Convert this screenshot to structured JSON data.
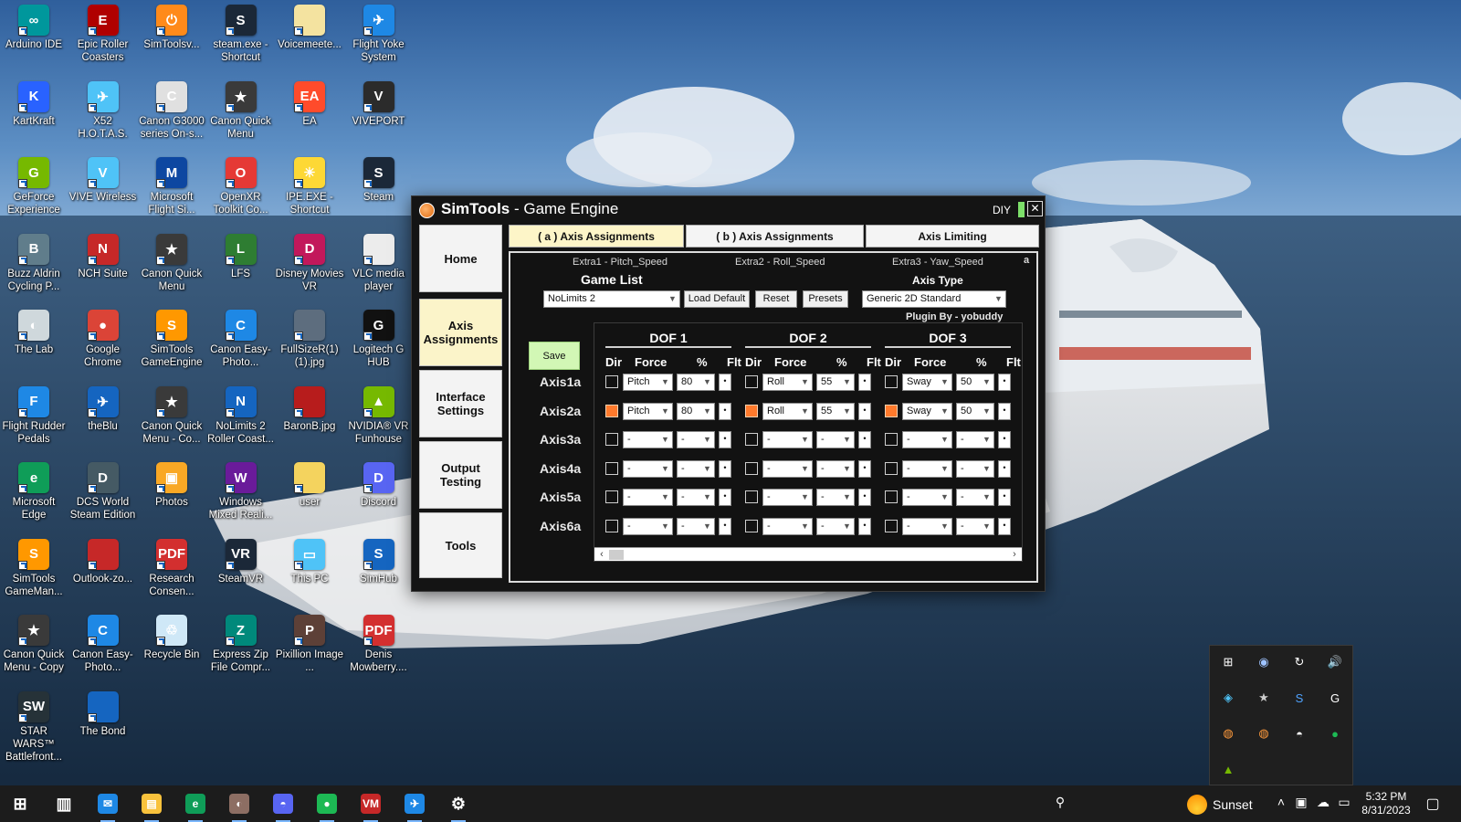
{
  "desktop_icons": [
    {
      "label": "Arduino IDE",
      "color": "#00979c",
      "glyph": "∞"
    },
    {
      "label": "Epic Roller Coasters",
      "color": "#b00000",
      "glyph": "E"
    },
    {
      "label": "SimToolsv...",
      "color": "#ff8a1a",
      "glyph": "⏻"
    },
    {
      "label": "steam.exe - Shortcut",
      "color": "#1b2838",
      "glyph": "S"
    },
    {
      "label": "Voicemeete...",
      "color": "#f4e3a0",
      "glyph": ""
    },
    {
      "label": "Flight Yoke System",
      "color": "#1e88e5",
      "glyph": "✈"
    },
    {
      "label": "KartKraft",
      "color": "#2962ff",
      "glyph": "K"
    },
    {
      "label": "X52 H.O.T.A.S.",
      "color": "#4fc3f7",
      "glyph": "✈"
    },
    {
      "label": "Canon G3000 series On-s...",
      "color": "#e0e0e0",
      "glyph": "C"
    },
    {
      "label": "Canon Quick Menu",
      "color": "#3a3a3a",
      "glyph": "★"
    },
    {
      "label": "EA",
      "color": "#ff4b2b",
      "glyph": "EA"
    },
    {
      "label": "VIVEPORT",
      "color": "#2b2b2b",
      "glyph": "V"
    },
    {
      "label": "GeForce Experience",
      "color": "#76b900",
      "glyph": "G"
    },
    {
      "label": "VIVE Wireless",
      "color": "#4fc3f7",
      "glyph": "V"
    },
    {
      "label": "Microsoft Flight Si...",
      "color": "#0d47a1",
      "glyph": "M"
    },
    {
      "label": "OpenXR Toolkit Co...",
      "color": "#e53935",
      "glyph": "O"
    },
    {
      "label": "IPE.EXE - Shortcut",
      "color": "#fdd835",
      "glyph": "☀"
    },
    {
      "label": "Steam",
      "color": "#1b2838",
      "glyph": "S"
    },
    {
      "label": "Buzz Aldrin Cycling P...",
      "color": "#607d8b",
      "glyph": "B"
    },
    {
      "label": "NCH Suite",
      "color": "#c62828",
      "glyph": "N"
    },
    {
      "label": "Canon Quick Menu",
      "color": "#3a3a3a",
      "glyph": "★"
    },
    {
      "label": "LFS",
      "color": "#2e7d32",
      "glyph": "L"
    },
    {
      "label": "Disney Movies VR",
      "color": "#c2185b",
      "glyph": "D"
    },
    {
      "label": "VLC media player",
      "color": "#ececec",
      "glyph": ""
    },
    {
      "label": "The Lab",
      "color": "#cfd8dc",
      "glyph": "◐"
    },
    {
      "label": "Google Chrome",
      "color": "#db4437",
      "glyph": "●"
    },
    {
      "label": "SimTools GameEngine",
      "color": "#ff9800",
      "glyph": "S"
    },
    {
      "label": "Canon Easy-Photo...",
      "color": "#1e88e5",
      "glyph": "C"
    },
    {
      "label": "FullSizeR(1) (1).jpg",
      "color": "#5d6d7e",
      "glyph": ""
    },
    {
      "label": "Logitech G HUB",
      "color": "#111111",
      "glyph": "G"
    },
    {
      "label": "Flight Rudder Pedals",
      "color": "#1e88e5",
      "glyph": "F"
    },
    {
      "label": "theBlu",
      "color": "#1565c0",
      "glyph": "✈"
    },
    {
      "label": "Canon Quick Menu - Co...",
      "color": "#3a3a3a",
      "glyph": "★"
    },
    {
      "label": "NoLimits 2 Roller Coast...",
      "color": "#1565c0",
      "glyph": "N"
    },
    {
      "label": "BaronB.jpg",
      "color": "#b71c1c",
      "glyph": ""
    },
    {
      "label": "NVIDIA® VR Funhouse",
      "color": "#76b900",
      "glyph": "▲"
    },
    {
      "label": "Microsoft Edge",
      "color": "#0f9d58",
      "glyph": "e"
    },
    {
      "label": "DCS World Steam Edition",
      "color": "#455a64",
      "glyph": "D"
    },
    {
      "label": "Photos",
      "color": "#f9a825",
      "glyph": "▣"
    },
    {
      "label": "Windows Mixed Reali...",
      "color": "#6a1b9a",
      "glyph": "W"
    },
    {
      "label": "user",
      "color": "#f4d35e",
      "glyph": ""
    },
    {
      "label": "Discord",
      "color": "#5865f2",
      "glyph": "D"
    },
    {
      "label": "SimTools GameMan...",
      "color": "#ff9800",
      "glyph": "S"
    },
    {
      "label": "Outlook-zo...",
      "color": "#c62828",
      "glyph": ""
    },
    {
      "label": "Research Consen...",
      "color": "#d32f2f",
      "glyph": "PDF"
    },
    {
      "label": "SteamVR",
      "color": "#1b2838",
      "glyph": "VR"
    },
    {
      "label": "This PC",
      "color": "#4fc3f7",
      "glyph": "▭"
    },
    {
      "label": "SimHub",
      "color": "#1565c0",
      "glyph": "S"
    },
    {
      "label": "Canon Quick Menu - Copy",
      "color": "#3a3a3a",
      "glyph": "★"
    },
    {
      "label": "Canon Easy-Photo...",
      "color": "#1e88e5",
      "glyph": "C"
    },
    {
      "label": "Recycle Bin",
      "color": "#cfe8f7",
      "glyph": "♲"
    },
    {
      "label": "Express Zip File Compr...",
      "color": "#00897b",
      "glyph": "Z"
    },
    {
      "label": "Pixillion Image ...",
      "color": "#5d4037",
      "glyph": "P"
    },
    {
      "label": "Denis Mowberry....",
      "color": "#d32f2f",
      "glyph": "PDF"
    },
    {
      "label": "STAR WARS™ Battlefront...",
      "color": "#263238",
      "glyph": "SW"
    },
    {
      "label": "The Bond",
      "color": "#1565c0",
      "glyph": ""
    }
  ],
  "window": {
    "title_bold": "SimTools",
    "title_rest": " - Game Engine",
    "diy": "DIY",
    "close": "✕"
  },
  "nav": [
    {
      "label": "Home"
    },
    {
      "label": "Axis Assignments",
      "active": true
    },
    {
      "label": "Interface Settings"
    },
    {
      "label": "Output Testing"
    },
    {
      "label": "Tools"
    }
  ],
  "tabs": [
    {
      "label": "( a ) Axis Assignments",
      "active": true
    },
    {
      "label": "( b ) Axis Assignments"
    },
    {
      "label": "Axis Limiting"
    }
  ],
  "panel": {
    "extra1": "Extra1 - Pitch_Speed",
    "extra2": "Extra2 - Roll_Speed",
    "extra3": "Extra3 - Yaw_Speed",
    "corner": "a",
    "game_list_label": "Game List",
    "game_selected": "NoLimits 2",
    "load_default": "Load Default",
    "reset": "Reset",
    "presets": "Presets",
    "axis_type_label": "Axis Type",
    "axis_type_selected": "Generic 2D Standard",
    "plugin_by": "Plugin By - yobuddy",
    "save": "Save"
  },
  "grid": {
    "dof_headers": [
      "DOF 1",
      "DOF 2",
      "DOF 3"
    ],
    "col_headers": {
      "dir": "Dir",
      "force": "Force",
      "pct": "%",
      "flt": "Flt"
    },
    "rows": [
      {
        "axis": "Axis1a",
        "dofs": [
          {
            "dir": false,
            "force": "Pitch",
            "pct": "80"
          },
          {
            "dir": false,
            "force": "Roll",
            "pct": "55"
          },
          {
            "dir": false,
            "force": "Sway",
            "pct": "50"
          }
        ]
      },
      {
        "axis": "Axis2a",
        "dofs": [
          {
            "dir": true,
            "force": "Pitch",
            "pct": "80"
          },
          {
            "dir": true,
            "force": "Roll",
            "pct": "55"
          },
          {
            "dir": true,
            "force": "Sway",
            "pct": "50"
          }
        ]
      },
      {
        "axis": "Axis3a",
        "dofs": [
          {
            "dir": false,
            "force": "-",
            "pct": "-"
          },
          {
            "dir": false,
            "force": "-",
            "pct": "-"
          },
          {
            "dir": false,
            "force": "-",
            "pct": "-"
          }
        ]
      },
      {
        "axis": "Axis4a",
        "dofs": [
          {
            "dir": false,
            "force": "-",
            "pct": "-"
          },
          {
            "dir": false,
            "force": "-",
            "pct": "-"
          },
          {
            "dir": false,
            "force": "-",
            "pct": "-"
          }
        ]
      },
      {
        "axis": "Axis5a",
        "dofs": [
          {
            "dir": false,
            "force": "-",
            "pct": "-"
          },
          {
            "dir": false,
            "force": "-",
            "pct": "-"
          },
          {
            "dir": false,
            "force": "-",
            "pct": "-"
          }
        ]
      },
      {
        "axis": "Axis6a",
        "dofs": [
          {
            "dir": false,
            "force": "-",
            "pct": "-"
          },
          {
            "dir": false,
            "force": "-",
            "pct": "-"
          },
          {
            "dir": false,
            "force": "-",
            "pct": "-"
          }
        ]
      }
    ],
    "flt_mark": "•",
    "scroll_left": "‹",
    "scroll_right": "›"
  },
  "tray_icons": [
    {
      "name": "windows-security-icon",
      "glyph": "⊞",
      "color": "#ffffff"
    },
    {
      "name": "steam-tray-icon",
      "glyph": "◉",
      "color": "#9fc3ff"
    },
    {
      "name": "sync-icon",
      "glyph": "↻",
      "color": "#ffffff"
    },
    {
      "name": "volume-tray-icon",
      "glyph": "🔊",
      "color": "#ffffff"
    },
    {
      "name": "vive-tray-icon",
      "glyph": "◈",
      "color": "#4fc3f7"
    },
    {
      "name": "canon-tray-icon",
      "glyph": "★",
      "color": "#cccccc"
    },
    {
      "name": "simhub-tray-icon",
      "glyph": "S",
      "color": "#4fa3ff"
    },
    {
      "name": "logitech-tray-icon",
      "glyph": "G",
      "color": "#ffffff"
    },
    {
      "name": "simtools-tray-icon",
      "glyph": "◍",
      "color": "#ff9a3c"
    },
    {
      "name": "simtools-gm-tray-icon",
      "glyph": "◍",
      "color": "#ff9a3c"
    },
    {
      "name": "discord-tray-icon",
      "glyph": "◓",
      "color": "#ffffff"
    },
    {
      "name": "spotify-tray-icon",
      "glyph": "●",
      "color": "#1db954"
    },
    {
      "name": "nvidia-tray-icon",
      "glyph": "▲",
      "color": "#76b900"
    }
  ],
  "taskbar": {
    "icons": [
      {
        "name": "start-button-icon",
        "glyph": "⊞",
        "color": "transparent"
      },
      {
        "name": "task-view-icon",
        "glyph": "▥",
        "color": "transparent"
      },
      {
        "name": "mail-icon",
        "glyph": "✉",
        "color": "#1e88e5"
      },
      {
        "name": "file-explorer-icon",
        "glyph": "▤",
        "color": "#f9c23c"
      },
      {
        "name": "edge-icon",
        "glyph": "e",
        "color": "#0f9d58"
      },
      {
        "name": "gimp-icon",
        "glyph": "◐",
        "color": "#8d6e63"
      },
      {
        "name": "discord-icon",
        "glyph": "◓",
        "color": "#5865f2"
      },
      {
        "name": "spotify-icon",
        "glyph": "●",
        "color": "#1db954"
      },
      {
        "name": "voicemeeter-icon",
        "glyph": "VM",
        "color": "#c62828"
      },
      {
        "name": "flight-yoke-icon",
        "glyph": "✈",
        "color": "#1e88e5"
      },
      {
        "name": "settings-icon",
        "glyph": "⚙",
        "color": "transparent"
      }
    ],
    "weather": "Sunset",
    "time": "5:32 PM",
    "date": "8/31/2023"
  }
}
